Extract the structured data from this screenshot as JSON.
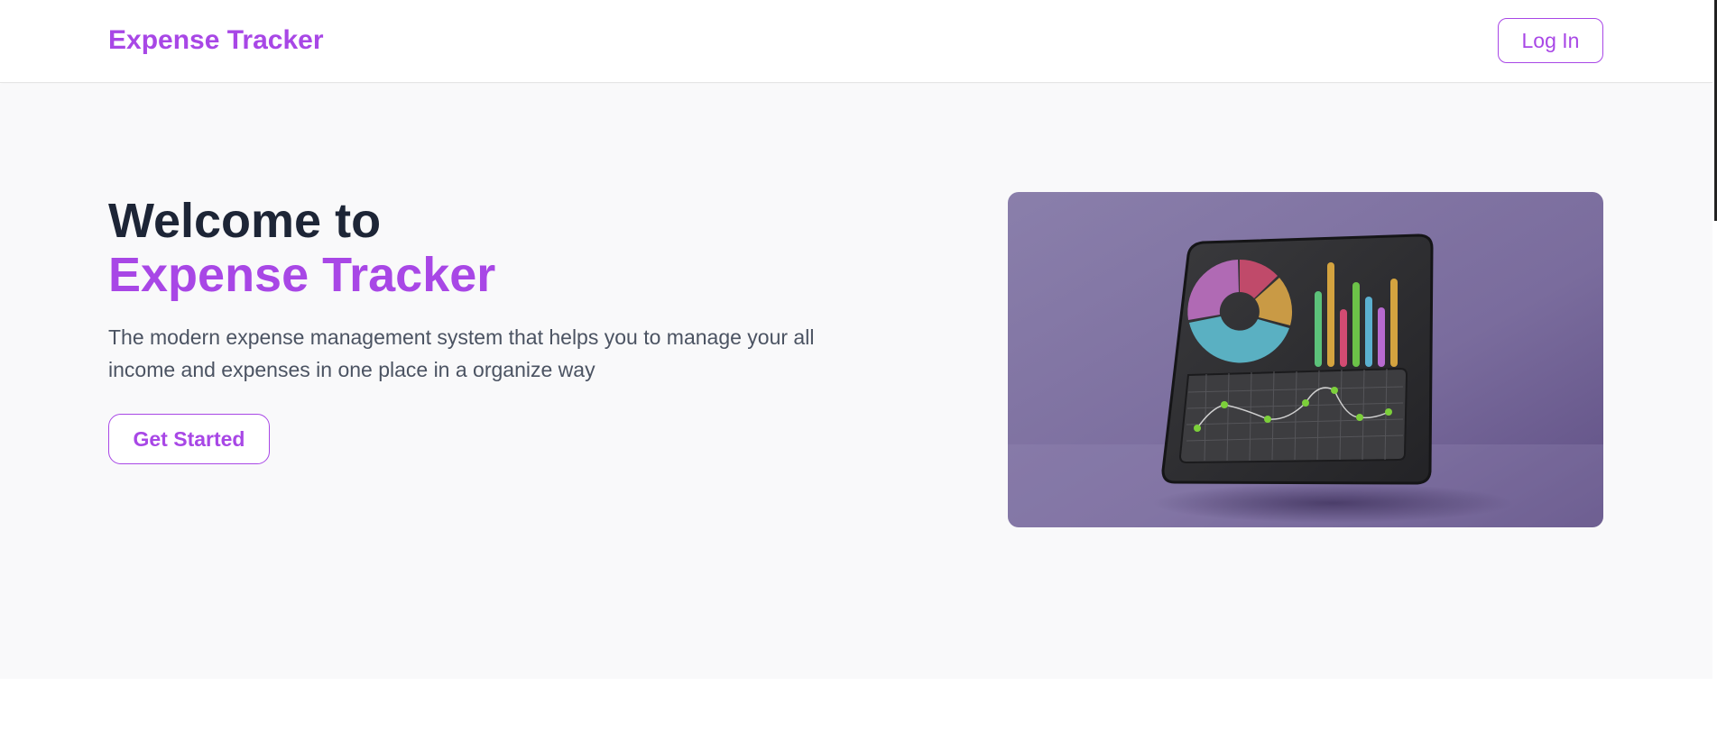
{
  "nav": {
    "brand": "Expense Tracker",
    "login_label": "Log In"
  },
  "hero": {
    "heading_line1": "Welcome to",
    "heading_line2": "Expense Tracker",
    "subtitle": "The modern expense management system that helps you to manage your all income and expenses in one place in a organize way",
    "cta_label": "Get Started"
  },
  "colors": {
    "accent": "#a847e6",
    "heading": "#1d2536",
    "body_text": "#4b5362",
    "hero_bg": "#f9f9fa",
    "image_bg": "#7d6fa3"
  }
}
